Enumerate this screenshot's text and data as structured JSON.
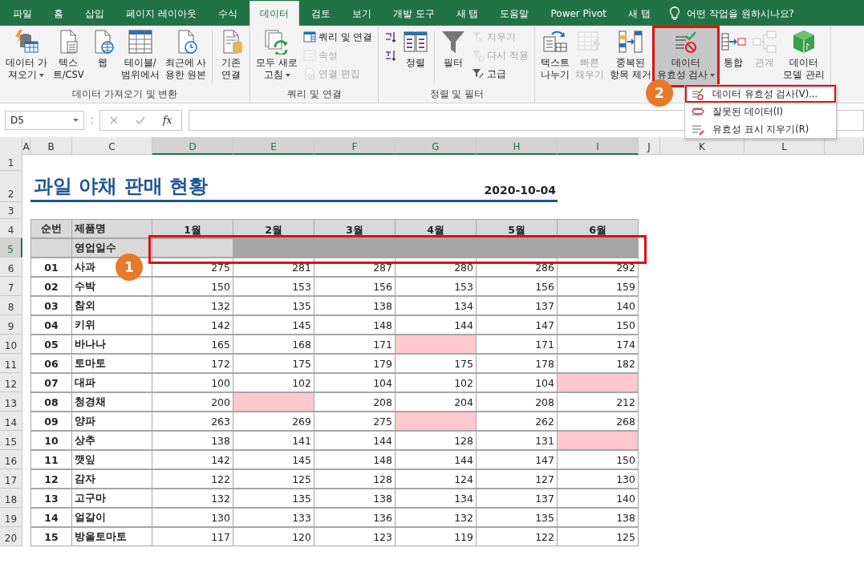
{
  "tabs": [
    {
      "label": "파일",
      "selected": false
    },
    {
      "label": "홈",
      "selected": false
    },
    {
      "label": "삽입",
      "selected": false
    },
    {
      "label": "페이지 레이아웃",
      "selected": false
    },
    {
      "label": "수식",
      "selected": false
    },
    {
      "label": "데이터",
      "selected": true
    },
    {
      "label": "검토",
      "selected": false
    },
    {
      "label": "보기",
      "selected": false
    },
    {
      "label": "개발 도구",
      "selected": false
    },
    {
      "label": "새 탭",
      "selected": false
    },
    {
      "label": "도움말",
      "selected": false
    },
    {
      "label": "Power Pivot",
      "selected": false
    },
    {
      "label": "새 탭",
      "selected": false
    }
  ],
  "tell_me": {
    "placeholder": "어떤 작업을 원하시나요?"
  },
  "ribbon": {
    "groups": [
      {
        "label": "데이터 가져오기 및 변환",
        "items": [
          {
            "kind": "large",
            "label": "데이터 가\n져오기",
            "dropdown": true,
            "disabled": false,
            "pressed": false
          },
          {
            "kind": "large",
            "label": "텍스\n트/CSV",
            "dropdown": false,
            "disabled": false,
            "pressed": false
          },
          {
            "kind": "large",
            "label": "웹",
            "dropdown": false,
            "disabled": false,
            "pressed": false
          },
          {
            "kind": "large",
            "label": "테이블/\n범위에서",
            "dropdown": false,
            "disabled": false,
            "pressed": false
          },
          {
            "kind": "large",
            "label": "최근에 사\n용한 원본",
            "dropdown": false,
            "disabled": false,
            "pressed": false
          },
          {
            "kind": "separator"
          },
          {
            "kind": "large",
            "label": "기존\n연결",
            "dropdown": false,
            "disabled": false,
            "pressed": false
          }
        ]
      },
      {
        "label": "쿼리 및 연결",
        "items": [
          {
            "kind": "large",
            "label": "모두 새로\n고침",
            "dropdown": true,
            "disabled": false,
            "pressed": false
          },
          {
            "kind": "stack",
            "items": [
              {
                "label": "쿼리 및 연결",
                "disabled": false
              },
              {
                "label": "속성",
                "disabled": true
              },
              {
                "label": "연결 편집",
                "disabled": true
              }
            ]
          }
        ]
      },
      {
        "label": "정렬 및 필터",
        "items": [
          {
            "kind": "stack",
            "items": [
              {
                "disabled": false
              },
              {
                "disabled": false
              }
            ]
          },
          {
            "kind": "large",
            "label": "정렬",
            "dropdown": false,
            "disabled": false,
            "pressed": false
          },
          {
            "kind": "separator"
          },
          {
            "kind": "large",
            "label": "필터",
            "dropdown": false,
            "disabled": false,
            "pressed": false
          },
          {
            "kind": "stack",
            "items": [
              {
                "label": "지우기",
                "disabled": true
              },
              {
                "label": "다시 적용",
                "disabled": true
              },
              {
                "label": "고급",
                "disabled": false
              }
            ]
          }
        ]
      },
      {
        "items": [
          {
            "kind": "large",
            "label": "텍스트\n나누기",
            "dropdown": false,
            "disabled": false,
            "pressed": false
          },
          {
            "kind": "large",
            "label": "빠른\n채우기",
            "dropdown": false,
            "disabled": true,
            "pressed": false
          },
          {
            "kind": "large",
            "label": "중복된\n항목 제거",
            "dropdown": false,
            "disabled": false,
            "pressed": false
          },
          {
            "kind": "large",
            "label": "데이터\n유효성 검사",
            "dropdown": true,
            "disabled": false,
            "pressed": true
          },
          {
            "kind": "large",
            "label": "통합",
            "dropdown": false,
            "disabled": false,
            "pressed": false
          },
          {
            "kind": "large",
            "label": "관계",
            "dropdown": false,
            "disabled": true,
            "pressed": false
          },
          {
            "kind": "large",
            "label": "데이터\n모델 관리",
            "dropdown": false,
            "disabled": false,
            "pressed": false
          }
        ]
      }
    ]
  },
  "dropdown_menu": {
    "items": [
      {
        "label": "데이터 유효성 검사(V)...",
        "selected": true
      },
      {
        "label": "잘못된 데이터(I)",
        "selected": false
      },
      {
        "label": "유효성 표시 지우기(R)",
        "selected": false
      }
    ]
  },
  "formula_bar": {
    "name_box": "D5",
    "function_label": "fx"
  },
  "sheet": {
    "columns": [
      {
        "label": "A",
        "selected": false
      },
      {
        "label": "B",
        "selected": false
      },
      {
        "label": "C",
        "selected": false
      },
      {
        "label": "D",
        "selected": true
      },
      {
        "label": "E",
        "selected": true
      },
      {
        "label": "F",
        "selected": true
      },
      {
        "label": "G",
        "selected": true
      },
      {
        "label": "H",
        "selected": true
      },
      {
        "label": "I",
        "selected": true
      },
      {
        "label": "J",
        "selected": false
      },
      {
        "label": "K",
        "selected": false
      },
      {
        "label": "L",
        "selected": false
      }
    ],
    "row_headers": [
      {
        "label": "1",
        "selected": false
      },
      {
        "label": "2",
        "selected": false
      },
      {
        "label": "3",
        "selected": false
      },
      {
        "label": "4",
        "selected": false
      },
      {
        "label": "5",
        "selected": true
      },
      {
        "label": "6",
        "selected": false
      },
      {
        "label": "7",
        "selected": false
      },
      {
        "label": "8",
        "selected": false
      },
      {
        "label": "9",
        "selected": false
      },
      {
        "label": "10",
        "selected": false
      },
      {
        "label": "11",
        "selected": false
      },
      {
        "label": "12",
        "selected": false
      },
      {
        "label": "13",
        "selected": false
      },
      {
        "label": "14",
        "selected": false
      },
      {
        "label": "15",
        "selected": false
      },
      {
        "label": "16",
        "selected": false
      },
      {
        "label": "17",
        "selected": false
      },
      {
        "label": "18",
        "selected": false
      },
      {
        "label": "19",
        "selected": false
      },
      {
        "label": "20",
        "selected": false
      }
    ],
    "title": "과일 야채 판매 현황",
    "date": "2020-10-04",
    "table": {
      "columns": [
        "순번",
        "제품명",
        "1월",
        "2월",
        "3월",
        "4월",
        "5월",
        "6월"
      ],
      "business_days": {
        "label": "영업일수",
        "selected": true
      },
      "rows": [
        {
          "no": "01",
          "name": "사과",
          "cells": [
            {
              "value": "275",
              "flagged": false
            },
            {
              "value": "281",
              "flagged": false
            },
            {
              "value": "287",
              "flagged": false
            },
            {
              "value": "280",
              "flagged": false
            },
            {
              "value": "286",
              "flagged": false
            },
            {
              "value": "292",
              "flagged": false
            }
          ]
        },
        {
          "no": "02",
          "name": "수박",
          "cells": [
            {
              "value": "150",
              "flagged": false
            },
            {
              "value": "153",
              "flagged": false
            },
            {
              "value": "156",
              "flagged": false
            },
            {
              "value": "153",
              "flagged": false
            },
            {
              "value": "156",
              "flagged": false
            },
            {
              "value": "159",
              "flagged": false
            }
          ]
        },
        {
          "no": "03",
          "name": "참외",
          "cells": [
            {
              "value": "132",
              "flagged": false
            },
            {
              "value": "135",
              "flagged": false
            },
            {
              "value": "138",
              "flagged": false
            },
            {
              "value": "134",
              "flagged": false
            },
            {
              "value": "137",
              "flagged": false
            },
            {
              "value": "140",
              "flagged": false
            }
          ]
        },
        {
          "no": "04",
          "name": "키위",
          "cells": [
            {
              "value": "142",
              "flagged": false
            },
            {
              "value": "145",
              "flagged": false
            },
            {
              "value": "148",
              "flagged": false
            },
            {
              "value": "144",
              "flagged": false
            },
            {
              "value": "147",
              "flagged": false
            },
            {
              "value": "150",
              "flagged": false
            }
          ]
        },
        {
          "no": "05",
          "name": "바나나",
          "cells": [
            {
              "value": "165",
              "flagged": false
            },
            {
              "value": "168",
              "flagged": false
            },
            {
              "value": "171",
              "flagged": false
            },
            {
              "flagged": true
            },
            {
              "value": "171",
              "flagged": false
            },
            {
              "value": "174",
              "flagged": false
            }
          ]
        },
        {
          "no": "06",
          "name": "토마토",
          "cells": [
            {
              "value": "172",
              "flagged": false
            },
            {
              "value": "175",
              "flagged": false
            },
            {
              "value": "179",
              "flagged": false
            },
            {
              "value": "175",
              "flagged": false
            },
            {
              "value": "178",
              "flagged": false
            },
            {
              "value": "182",
              "flagged": false
            }
          ]
        },
        {
          "no": "07",
          "name": "대파",
          "cells": [
            {
              "value": "100",
              "flagged": false
            },
            {
              "value": "102",
              "flagged": false
            },
            {
              "value": "104",
              "flagged": false
            },
            {
              "value": "102",
              "flagged": false
            },
            {
              "value": "104",
              "flagged": false
            },
            {
              "flagged": true
            }
          ]
        },
        {
          "no": "08",
          "name": "청경채",
          "cells": [
            {
              "value": "200",
              "flagged": false
            },
            {
              "flagged": true
            },
            {
              "value": "208",
              "flagged": false
            },
            {
              "value": "204",
              "flagged": false
            },
            {
              "value": "208",
              "flagged": false
            },
            {
              "value": "212",
              "flagged": false
            }
          ]
        },
        {
          "no": "09",
          "name": "양파",
          "cells": [
            {
              "value": "263",
              "flagged": false
            },
            {
              "value": "269",
              "flagged": false
            },
            {
              "value": "275",
              "flagged": false
            },
            {
              "flagged": true
            },
            {
              "value": "262",
              "flagged": false
            },
            {
              "value": "268",
              "flagged": false
            }
          ]
        },
        {
          "no": "10",
          "name": "상추",
          "cells": [
            {
              "value": "138",
              "flagged": false
            },
            {
              "value": "141",
              "flagged": false
            },
            {
              "value": "144",
              "flagged": false
            },
            {
              "value": "128",
              "flagged": false
            },
            {
              "value": "131",
              "flagged": false
            },
            {
              "flagged": true
            }
          ]
        },
        {
          "no": "11",
          "name": "깻잎",
          "cells": [
            {
              "value": "142",
              "flagged": false
            },
            {
              "value": "145",
              "flagged": false
            },
            {
              "value": "148",
              "flagged": false
            },
            {
              "value": "144",
              "flagged": false
            },
            {
              "value": "147",
              "flagged": false
            },
            {
              "value": "150",
              "flagged": false
            }
          ]
        },
        {
          "no": "12",
          "name": "감자",
          "cells": [
            {
              "value": "122",
              "flagged": false
            },
            {
              "value": "125",
              "flagged": false
            },
            {
              "value": "128",
              "flagged": false
            },
            {
              "value": "124",
              "flagged": false
            },
            {
              "value": "127",
              "flagged": false
            },
            {
              "value": "130",
              "flagged": false
            }
          ]
        },
        {
          "no": "13",
          "name": "고구마",
          "cells": [
            {
              "value": "132",
              "flagged": false
            },
            {
              "value": "135",
              "flagged": false
            },
            {
              "value": "138",
              "flagged": false
            },
            {
              "value": "134",
              "flagged": false
            },
            {
              "value": "137",
              "flagged": false
            },
            {
              "value": "140",
              "flagged": false
            }
          ]
        },
        {
          "no": "14",
          "name": "얼갈이",
          "cells": [
            {
              "value": "130",
              "flagged": false
            },
            {
              "value": "133",
              "flagged": false
            },
            {
              "value": "136",
              "flagged": false
            },
            {
              "value": "132",
              "flagged": false
            },
            {
              "value": "135",
              "flagged": false
            },
            {
              "value": "138",
              "flagged": false
            }
          ]
        },
        {
          "no": "15",
          "name": "방울토마토",
          "cells": [
            {
              "value": "117",
              "flagged": false
            },
            {
              "value": "120",
              "flagged": false
            },
            {
              "value": "123",
              "flagged": false
            },
            {
              "value": "119",
              "flagged": false
            },
            {
              "value": "122",
              "flagged": false
            },
            {
              "value": "125",
              "flagged": false
            }
          ]
        }
      ]
    }
  },
  "annotations": [
    {
      "label": "1"
    },
    {
      "label": "2"
    }
  ]
}
